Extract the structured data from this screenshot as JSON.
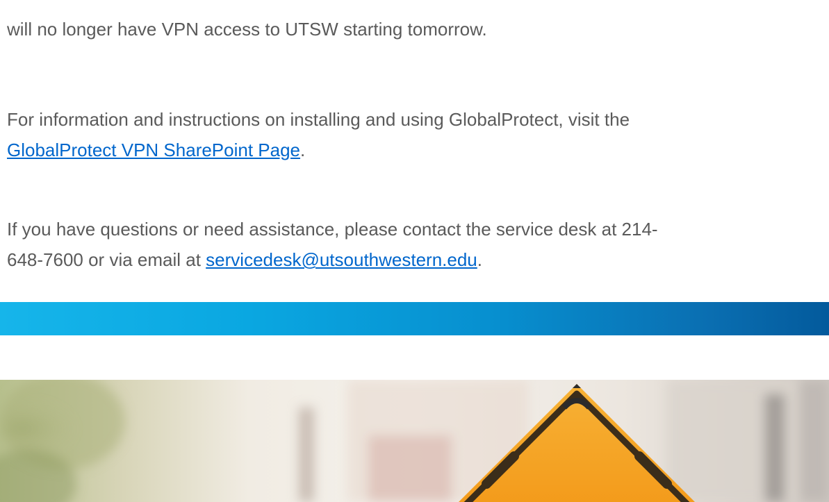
{
  "email": {
    "partial_line_top": "will no longer have VPN access to UTSW starting tomorrow.",
    "paragraph_2": {
      "lead": "For information and instructions on installing and using GlobalProtect, visit the",
      "link_text": "GlobalProtect VPN SharePoint Page",
      "trail": "."
    },
    "paragraph_3": {
      "line1": "If you have questions or need assistance, please contact the service desk at 214-",
      "line2_lead": "648-7600 or via email at ",
      "email_link": "servicedesk@utsouthwestern.edu",
      "trail": "."
    }
  },
  "banner": {
    "image_name": "construction-warning-sign-photo",
    "sign_color": "#f5a623"
  },
  "divider": {
    "gradient_start": "#16b5ea",
    "gradient_end": "#035a9c"
  }
}
